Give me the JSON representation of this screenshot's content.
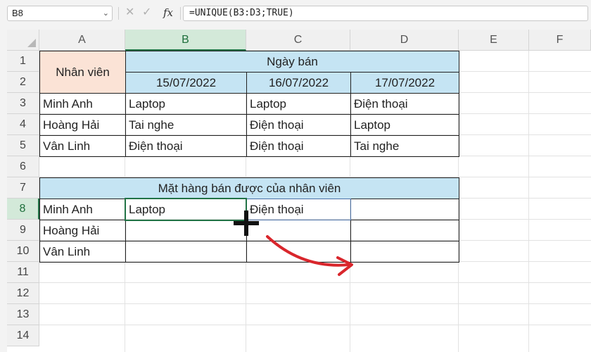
{
  "formula_bar": {
    "name_box": "B8",
    "cancel_icon": "close-icon",
    "enter_icon": "checkmark-icon",
    "fx_label": "fx",
    "formula": "=UNIQUE(B3:D3;TRUE)"
  },
  "columns": [
    "A",
    "B",
    "C",
    "D",
    "E",
    "F"
  ],
  "rows": [
    "1",
    "2",
    "3",
    "4",
    "5",
    "6",
    "7",
    "8",
    "9",
    "10",
    "11",
    "12",
    "13",
    "14"
  ],
  "table": {
    "employee_header": "Nhân viên",
    "sale_date_header": "Ngày bán",
    "dates": [
      "15/07/2022",
      "16/07/2022",
      "17/07/2022"
    ],
    "records": [
      {
        "name": "Minh Anh",
        "items": [
          "Laptop",
          "Laptop",
          "Điện thoại"
        ]
      },
      {
        "name": "Hoàng Hải",
        "items": [
          "Tai nghe",
          "Điện thoại",
          "Laptop"
        ]
      },
      {
        "name": "Vân Linh",
        "items": [
          "Điện thoại",
          "Điện thoại",
          "Tai nghe"
        ]
      }
    ]
  },
  "result_table": {
    "title": "Mặt hàng bán được của nhân viên",
    "rows": [
      {
        "name": "Minh Anh",
        "values": [
          "Laptop",
          "Điện thoại",
          ""
        ]
      },
      {
        "name": "Hoàng Hải",
        "values": [
          "",
          "",
          ""
        ]
      },
      {
        "name": "Vân Linh",
        "values": [
          "",
          "",
          ""
        ]
      }
    ]
  },
  "colors": {
    "selection": "#217346",
    "header_pink": "#fbe3d6",
    "header_blue": "#c5e4f3",
    "arrow": "#d9262c"
  }
}
